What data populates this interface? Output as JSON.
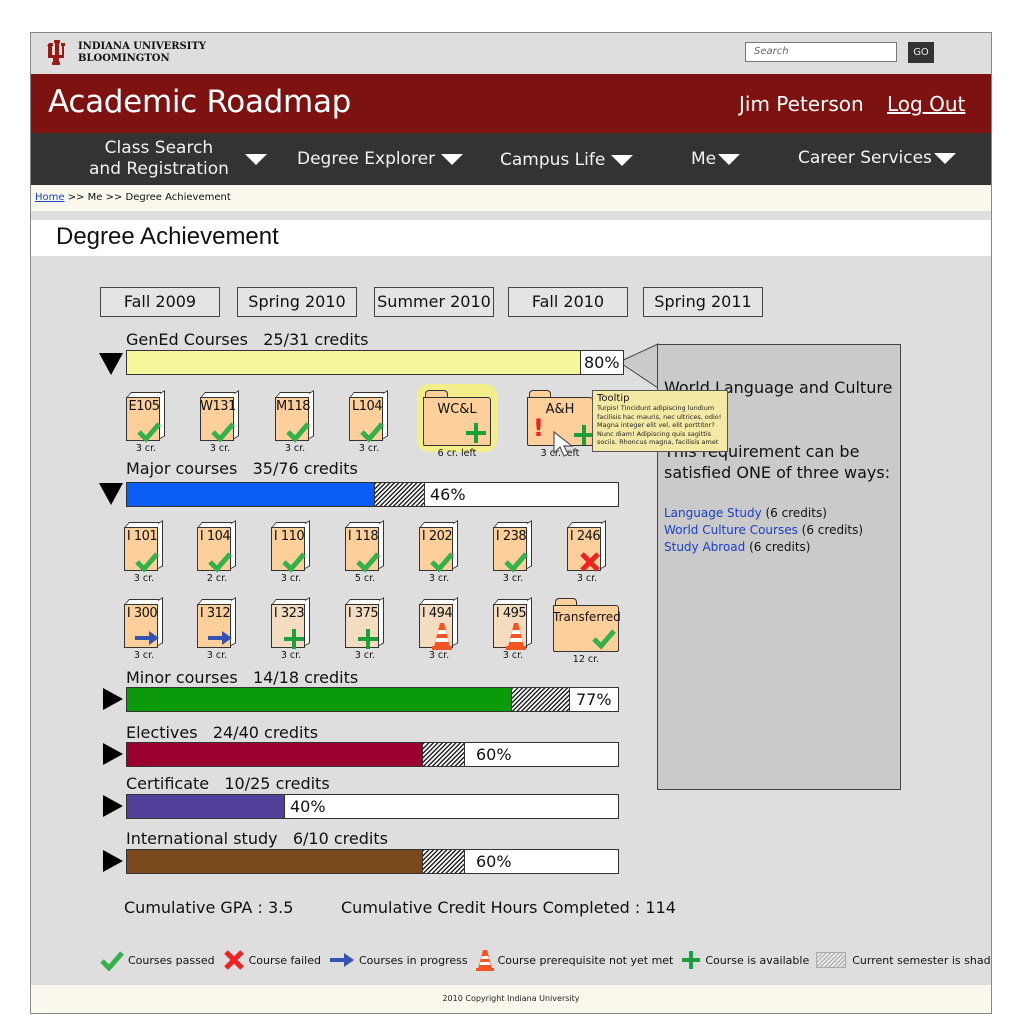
{
  "header": {
    "university_line1": "INDIANA UNIVERSITY",
    "university_line2": "BLOOMINGTON",
    "search_placeholder": "Search",
    "go_label": "GO",
    "app_title": "Academic Roadmap",
    "user_name": "Jim Peterson",
    "logout_label": "Log Out"
  },
  "nav": {
    "items": [
      {
        "label_line1": "Class Search",
        "label_line2": "and Registration"
      },
      {
        "label": "Degree Explorer"
      },
      {
        "label": "Campus Life"
      },
      {
        "label": "Me"
      },
      {
        "label": "Career Services"
      }
    ]
  },
  "breadcrumb": {
    "home": "Home",
    "rest": " >> Me >> Degree Achievement"
  },
  "page_title": "Degree Achievement",
  "semesters": [
    "Fall 2009",
    "Spring 2010",
    "Summer 2010",
    "Fall 2010",
    "Spring 2011"
  ],
  "sections": [
    {
      "name": "GenEd Courses",
      "credits": "25/31 credits",
      "percent_label": "80%",
      "completed_fraction": 0.8,
      "current_fraction": 0,
      "color": "#f4f79a",
      "expanded": true,
      "courses": [
        {
          "code": "E105",
          "credits": "3 cr.",
          "status": "passed"
        },
        {
          "code": "W131",
          "credits": "3 cr.",
          "status": "passed"
        },
        {
          "code": "M118",
          "credits": "3 cr.",
          "status": "passed"
        },
        {
          "code": "L104",
          "credits": "3 cr.",
          "status": "passed"
        },
        {
          "code": "WC&L",
          "credits": "6 cr. left",
          "status": "available",
          "type": "folder",
          "highlighted": true
        },
        {
          "code": "A&H",
          "credits": "3 cr. left",
          "status": "warning",
          "type": "folder"
        }
      ]
    },
    {
      "name": "Major courses",
      "credits": "35/76 credits",
      "percent_label": "46%",
      "completed_fraction": 0.46,
      "current_fraction": 0.1,
      "color": "#0a5cf5",
      "expanded": true,
      "courses": [
        {
          "code": "I 101",
          "credits": "3 cr.",
          "status": "passed"
        },
        {
          "code": "I 104",
          "credits": "2 cr.",
          "status": "passed"
        },
        {
          "code": "I 110",
          "credits": "3 cr.",
          "status": "passed"
        },
        {
          "code": "I 118",
          "credits": "5 cr.",
          "status": "passed"
        },
        {
          "code": "I 202",
          "credits": "3 cr.",
          "status": "passed"
        },
        {
          "code": "I 238",
          "credits": "3 cr.",
          "status": "passed"
        },
        {
          "code": "I 246",
          "credits": "3 cr.",
          "status": "failed"
        },
        {
          "code": "I 300",
          "credits": "3 cr.",
          "status": "in-progress"
        },
        {
          "code": "I 312",
          "credits": "3 cr.",
          "status": "in-progress"
        },
        {
          "code": "I 323",
          "credits": "3 cr.",
          "status": "available"
        },
        {
          "code": "I 375",
          "credits": "3 cr.",
          "status": "available"
        },
        {
          "code": "I 494",
          "credits": "3 cr.",
          "status": "prereq-not-met"
        },
        {
          "code": "I 495",
          "credits": "3 cr.",
          "status": "prereq-not-met"
        },
        {
          "code": "Transferred",
          "credits": "12 cr.",
          "status": "passed",
          "type": "folder"
        }
      ]
    },
    {
      "name": "Minor courses",
      "credits": "14/18 credits",
      "percent_label": "77%",
      "completed_fraction": 0.77,
      "current_fraction": 0.12,
      "color": "#0a9a0a",
      "expanded": false
    },
    {
      "name": "Electives",
      "credits": "24/40 credits",
      "percent_label": "60%",
      "completed_fraction": 0.6,
      "current_fraction": 0.09,
      "color": "#9a0030",
      "expanded": false
    },
    {
      "name": "Certificate",
      "credits": "10/25 credits",
      "percent_label": "40%",
      "completed_fraction": 0.4,
      "current_fraction": 0,
      "color": "#52409a",
      "expanded": false
    },
    {
      "name": "International study",
      "credits": "6/10 credits",
      "percent_label": "60%",
      "completed_fraction": 0.6,
      "current_fraction": 0.09,
      "color": "#7a4a1c",
      "expanded": false
    }
  ],
  "detail_panel": {
    "title": "World Language and Culture",
    "description": "This requirement can be satisfied ONE of three ways:",
    "options": [
      {
        "link": "Language Study",
        "credits": " (6 credits)"
      },
      {
        "link": "World Culture Courses",
        "credits": " (6 credits)"
      },
      {
        "link": "Study Abroad",
        "credits": " (6 credits)"
      }
    ]
  },
  "tooltip": {
    "title": "Tooltip",
    "body": "Turpis! Tincidunt adipiscing lundium facilisis hac mauris, nec ultrices, odio! Magna integer elit vel, elit porttitor? Nunc diam! Adipiscing quis sagittis sociis. Rhoncus magna, facilisis amet"
  },
  "stats": {
    "gpa": "Cumulative GPA : 3.5",
    "credit_hours": "Cumulative Credit Hours Completed : 114"
  },
  "legend": [
    {
      "icon": "check-icon",
      "label": "Courses passed"
    },
    {
      "icon": "x-icon",
      "label": "Course failed"
    },
    {
      "icon": "arrow-right-icon",
      "label": "Courses in progress"
    },
    {
      "icon": "traffic-cone-icon",
      "label": "Course prerequisite not yet met"
    },
    {
      "icon": "plus-icon",
      "label": "Course is available"
    },
    {
      "icon": "hatch-swatch-icon",
      "label": "Current semester is shaded"
    }
  ],
  "footer": "2010 Copyright Indiana University"
}
